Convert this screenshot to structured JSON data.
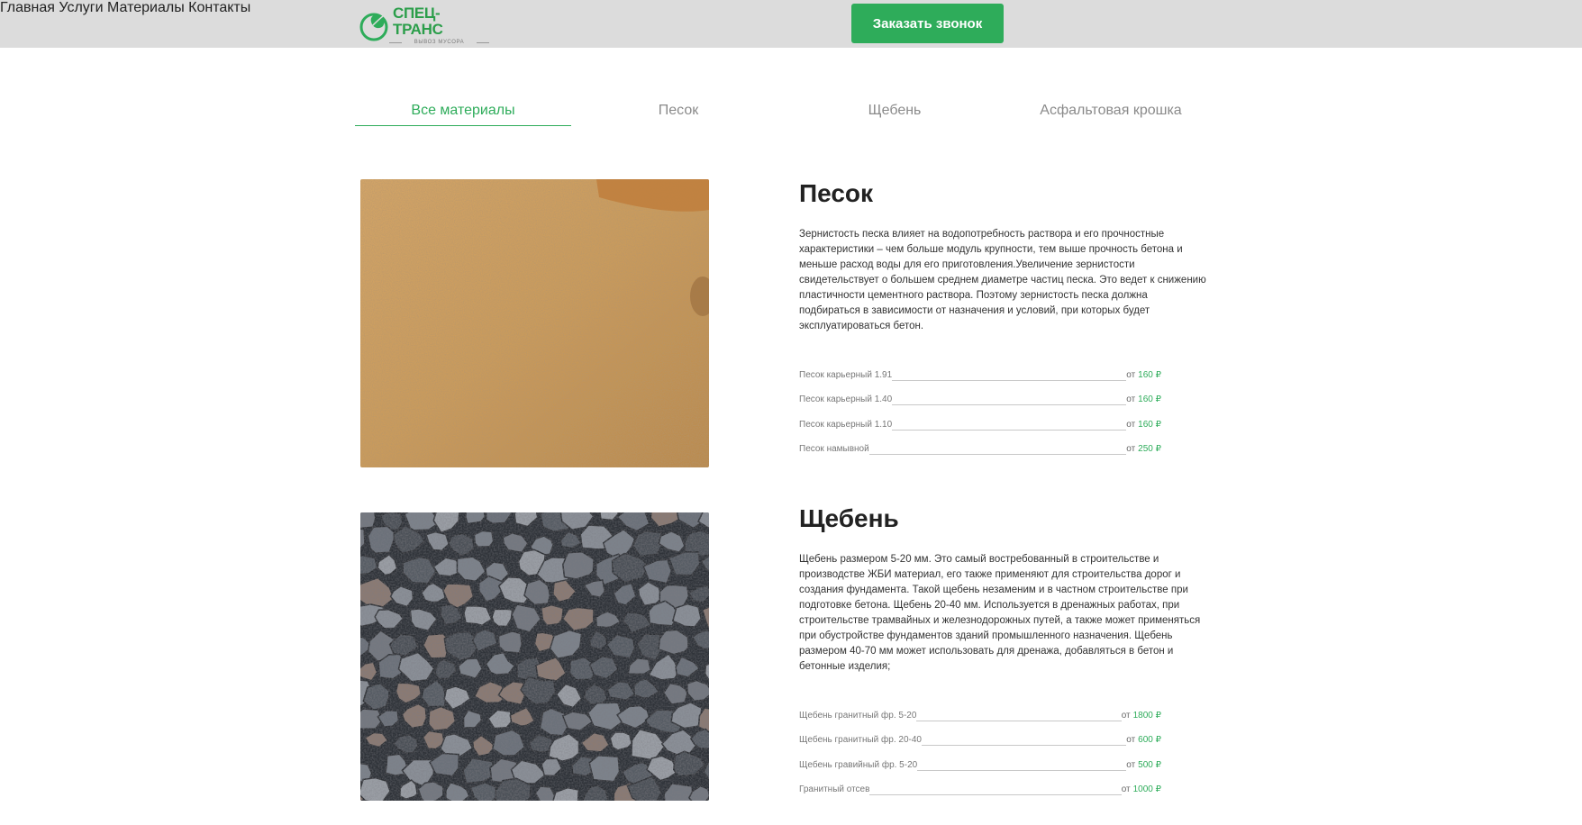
{
  "header": {
    "logo": {
      "name": "СПЕЦ-ТРАНС",
      "subtitle": "ВЫВОЗ МУСОРА"
    },
    "nav": [
      "Главная",
      "Услуги",
      "Материалы",
      "Контакты"
    ],
    "cta_label": "Заказать звонок"
  },
  "tabs": [
    {
      "label": "Все материалы",
      "active": true
    },
    {
      "label": "Песок",
      "active": false
    },
    {
      "label": "Щебень",
      "active": false
    },
    {
      "label": "Асфальтовая крошка",
      "active": false
    }
  ],
  "products": [
    {
      "title": "Песок",
      "description": "Зернистость песка влияет на водопотребность раствора и его прочностные характеристики – чем больше модуль крупности, тем выше прочность бетона и меньше расход воды для его приготовления.Увеличение зернистости свидетельствует о большем среднем диаметре частиц песка. Это ведет к снижению пластичности цементного раствора. Поэтому зернистость песка должна подбираться в зависимости от назначения и условий, при которых будет эксплуатироваться бетон.",
      "prices": [
        {
          "name": "Песок карьерный 1.91",
          "from": "от",
          "value": "160 ₽"
        },
        {
          "name": "Песок карьерный 1.40",
          "from": "от",
          "value": "160 ₽"
        },
        {
          "name": "Песок карьерный 1.10",
          "from": "от",
          "value": "160 ₽"
        },
        {
          "name": "Песок намывной",
          "from": "от",
          "value": "250 ₽"
        }
      ]
    },
    {
      "title": "Щебень",
      "description": "Щебень размером 5-20 мм. Это самый востребованный в строительстве и производстве ЖБИ материал, его также применяют для строительства дорог и создания фундамента. Такой щебень незаменим и в частном строительстве при подготовке бетона. Щебень 20-40 мм. Используется в дренажных работах, при строительстве трамвайных и железнодорожных путей, а также может применяться при обустройстве фундаментов зданий промышленного назначения. Щебень размером 40-70 мм может использовать для дренажа, добавляться в бетон и бетонные изделия;",
      "prices": [
        {
          "name": "Щебень гранитный фр. 5-20",
          "from": "от",
          "value": "1800 ₽"
        },
        {
          "name": "Щебень гранитный фр. 20-40",
          "from": "от",
          "value": "600 ₽"
        },
        {
          "name": "Щебень гравийный фр. 5-20",
          "from": "от",
          "value": "500 ₽"
        },
        {
          "name": "Гранитный отсев",
          "from": "от",
          "value": "1000 ₽"
        }
      ]
    }
  ],
  "colors": {
    "accent": "#2eac5a",
    "header_bg": "#dcdcdc",
    "sand": "#c99a5b",
    "gravel": "#5d636b"
  }
}
